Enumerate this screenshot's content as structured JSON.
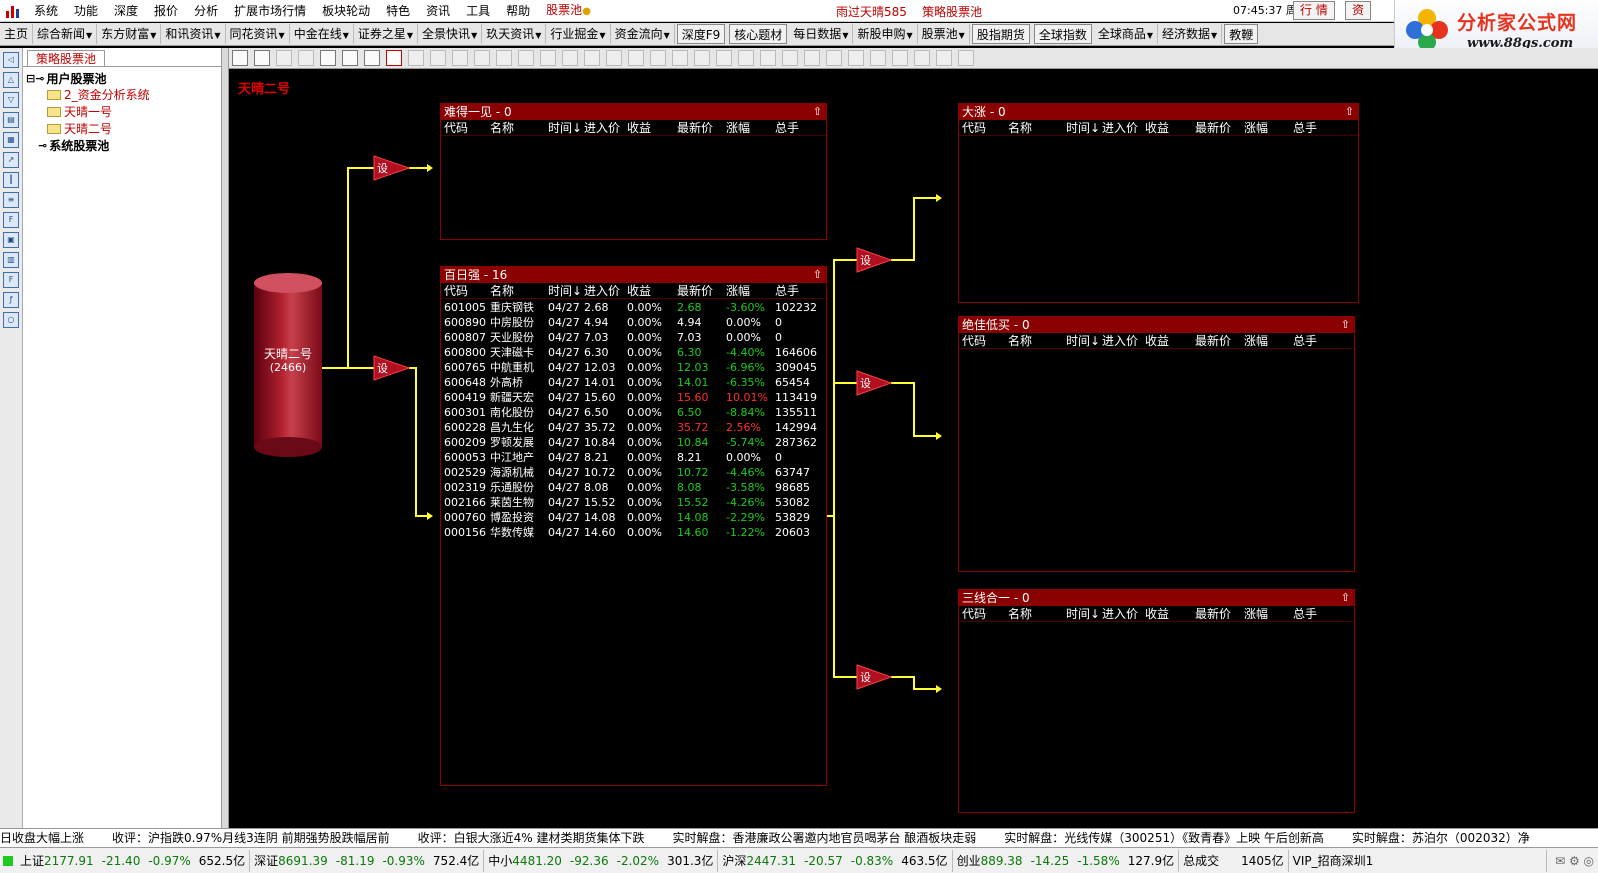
{
  "menu": {
    "items": [
      "系统",
      "功能",
      "深度",
      "报价",
      "分析",
      "扩展市场行情",
      "板块轮动",
      "特色",
      "资讯",
      "工具",
      "帮助"
    ],
    "pool_label": "股票池",
    "center_title_1": "雨过天晴585",
    "center_title_2": "策略股票池",
    "clock": "07:45:37 周日",
    "btn_quote": "行  情",
    "btn_info": "资"
  },
  "brand": {
    "title": "分析家公式网",
    "url": "www.88gs.com"
  },
  "toolbar": {
    "items": [
      {
        "label": "主页",
        "dd": false,
        "btn": false
      },
      {
        "label": "综合新闻",
        "dd": true,
        "btn": false
      },
      {
        "label": "东方财富",
        "dd": true,
        "btn": false
      },
      {
        "label": "和讯资讯",
        "dd": true,
        "btn": false
      },
      {
        "label": "同花资讯",
        "dd": true,
        "btn": false
      },
      {
        "label": "中金在线",
        "dd": true,
        "btn": false
      },
      {
        "label": "证券之星",
        "dd": true,
        "btn": false
      },
      {
        "label": "全景快讯",
        "dd": true,
        "btn": false
      },
      {
        "label": "玖天资讯",
        "dd": true,
        "btn": false
      },
      {
        "label": "行业掘金",
        "dd": true,
        "btn": false
      },
      {
        "label": "资金流向",
        "dd": true,
        "btn": false
      },
      {
        "label": "深度F9",
        "dd": false,
        "btn": true
      },
      {
        "label": "核心题材",
        "dd": false,
        "btn": true
      },
      {
        "label": "每日数据",
        "dd": true,
        "btn": false
      },
      {
        "label": "新股申购",
        "dd": true,
        "btn": false
      },
      {
        "label": "股票池",
        "dd": true,
        "btn": false
      },
      {
        "label": "股指期货",
        "dd": false,
        "btn": true
      },
      {
        "label": "全球指数",
        "dd": false,
        "btn": true
      },
      {
        "label": "全球商品",
        "dd": true,
        "btn": false
      },
      {
        "label": "经济数据",
        "dd": true,
        "btn": false
      },
      {
        "label": "教鞭",
        "dd": false,
        "btn": true
      }
    ]
  },
  "tree": {
    "tab": "策略股票池",
    "user_pool": "用户股票池",
    "items": [
      "2_资金分析系统",
      "天晴一号",
      "天晴二号"
    ],
    "system_pool": "系统股票池"
  },
  "canvas": {
    "title": "天晴二号"
  },
  "source": {
    "name": "天晴二号",
    "count": "(2466)"
  },
  "set_label": "设",
  "columns": [
    "代码",
    "名称",
    "时间↓",
    "进入价",
    "收益",
    "最新价",
    "涨幅",
    "总手"
  ],
  "panels": {
    "p1": {
      "name": "难得一见",
      "count": "0"
    },
    "p2": {
      "name": "百日强",
      "count": "16"
    },
    "p3": {
      "name": "大涨",
      "count": "0"
    },
    "p4": {
      "name": "绝佳低买",
      "count": "0"
    },
    "p5": {
      "name": "三线合一",
      "count": "0"
    }
  },
  "rows": [
    {
      "code": "601005",
      "name": "重庆钢铁",
      "time": "04/27",
      "entry": "2.68",
      "gain": "0.00%",
      "last": "2.68",
      "chg": "-3.60%",
      "vol": "102232",
      "dir": "g"
    },
    {
      "code": "600890",
      "name": "中房股份",
      "time": "04/27",
      "entry": "4.94",
      "gain": "0.00%",
      "last": "4.94",
      "chg": "0.00%",
      "vol": "0",
      "dir": "w"
    },
    {
      "code": "600807",
      "name": "天业股份",
      "time": "04/27",
      "entry": "7.03",
      "gain": "0.00%",
      "last": "7.03",
      "chg": "0.00%",
      "vol": "0",
      "dir": "w"
    },
    {
      "code": "600800",
      "name": "天津磁卡",
      "time": "04/27",
      "entry": "6.30",
      "gain": "0.00%",
      "last": "6.30",
      "chg": "-4.40%",
      "vol": "164606",
      "dir": "g"
    },
    {
      "code": "600765",
      "name": "中航重机",
      "time": "04/27",
      "entry": "12.03",
      "gain": "0.00%",
      "last": "12.03",
      "chg": "-6.96%",
      "vol": "309045",
      "dir": "g"
    },
    {
      "code": "600648",
      "name": "外高桥",
      "time": "04/27",
      "entry": "14.01",
      "gain": "0.00%",
      "last": "14.01",
      "chg": "-6.35%",
      "vol": "65454",
      "dir": "g"
    },
    {
      "code": "600419",
      "name": "新疆天宏",
      "time": "04/27",
      "entry": "15.60",
      "gain": "0.00%",
      "last": "15.60",
      "chg": "10.01%",
      "vol": "113419",
      "dir": "r"
    },
    {
      "code": "600301",
      "name": "南化股份",
      "time": "04/27",
      "entry": "6.50",
      "gain": "0.00%",
      "last": "6.50",
      "chg": "-8.84%",
      "vol": "135511",
      "dir": "g"
    },
    {
      "code": "600228",
      "name": "昌九生化",
      "time": "04/27",
      "entry": "35.72",
      "gain": "0.00%",
      "last": "35.72",
      "chg": "2.56%",
      "vol": "142994",
      "dir": "r"
    },
    {
      "code": "600209",
      "name": "罗顿发展",
      "time": "04/27",
      "entry": "10.84",
      "gain": "0.00%",
      "last": "10.84",
      "chg": "-5.74%",
      "vol": "287362",
      "dir": "g"
    },
    {
      "code": "600053",
      "name": "中江地产",
      "time": "04/27",
      "entry": "8.21",
      "gain": "0.00%",
      "last": "8.21",
      "chg": "0.00%",
      "vol": "0",
      "dir": "w"
    },
    {
      "code": "002529",
      "name": "海源机械",
      "time": "04/27",
      "entry": "10.72",
      "gain": "0.00%",
      "last": "10.72",
      "chg": "-4.46%",
      "vol": "63747",
      "dir": "g"
    },
    {
      "code": "002319",
      "name": "乐通股份",
      "time": "04/27",
      "entry": "8.08",
      "gain": "0.00%",
      "last": "8.08",
      "chg": "-3.58%",
      "vol": "98685",
      "dir": "g"
    },
    {
      "code": "002166",
      "name": "莱茵生物",
      "time": "04/27",
      "entry": "15.52",
      "gain": "0.00%",
      "last": "15.52",
      "chg": "-4.26%",
      "vol": "53082",
      "dir": "g"
    },
    {
      "code": "000760",
      "name": "博盈投资",
      "time": "04/27",
      "entry": "14.08",
      "gain": "0.00%",
      "last": "14.08",
      "chg": "-2.29%",
      "vol": "53829",
      "dir": "g"
    },
    {
      "code": "000156",
      "name": "华数传媒",
      "time": "04/27",
      "entry": "14.60",
      "gain": "0.00%",
      "last": "14.60",
      "chg": "-1.22%",
      "vol": "20603",
      "dir": "g"
    }
  ],
  "ticker": [
    "日收盘大幅上涨",
    "收评：沪指跌0.97%月线3连阴 前期强势股跌幅居前",
    "收评：白银大涨近4% 建材类期货集体下跌",
    "实时解盘：香港廉政公署邀内地官员喝茅台 酿酒板块走弱",
    "实时解盘：光线传媒（300251）《致青春》上映 午后创新高",
    "实时解盘：苏泊尔（002032）净"
  ],
  "status": [
    {
      "name": "上证",
      "val": "2177.91",
      "d1": "-21.40",
      "d2": "-0.97%",
      "size": "652.5亿"
    },
    {
      "name": "深证",
      "val": "8691.39",
      "d1": "-81.19",
      "d2": "-0.93%",
      "size": "752.4亿"
    },
    {
      "name": "中小",
      "val": "4481.20",
      "d1": "-92.36",
      "d2": "-2.02%",
      "size": "301.3亿"
    },
    {
      "name": "沪深",
      "val": "2447.31",
      "d1": "-20.57",
      "d2": "-0.83%",
      "size": "463.5亿"
    },
    {
      "name": "创业",
      "val": "889.38",
      "d1": "-14.25",
      "d2": "-1.58%",
      "size": "127.9亿"
    }
  ],
  "status_total_label": "总成交",
  "status_total": "1405亿",
  "status_account": "VIP_招商深圳1",
  "colors": {
    "panel_header": "#8b0000",
    "flow_line": "#ffff33",
    "up": "#ff3030",
    "down": "#1ecb1e"
  }
}
